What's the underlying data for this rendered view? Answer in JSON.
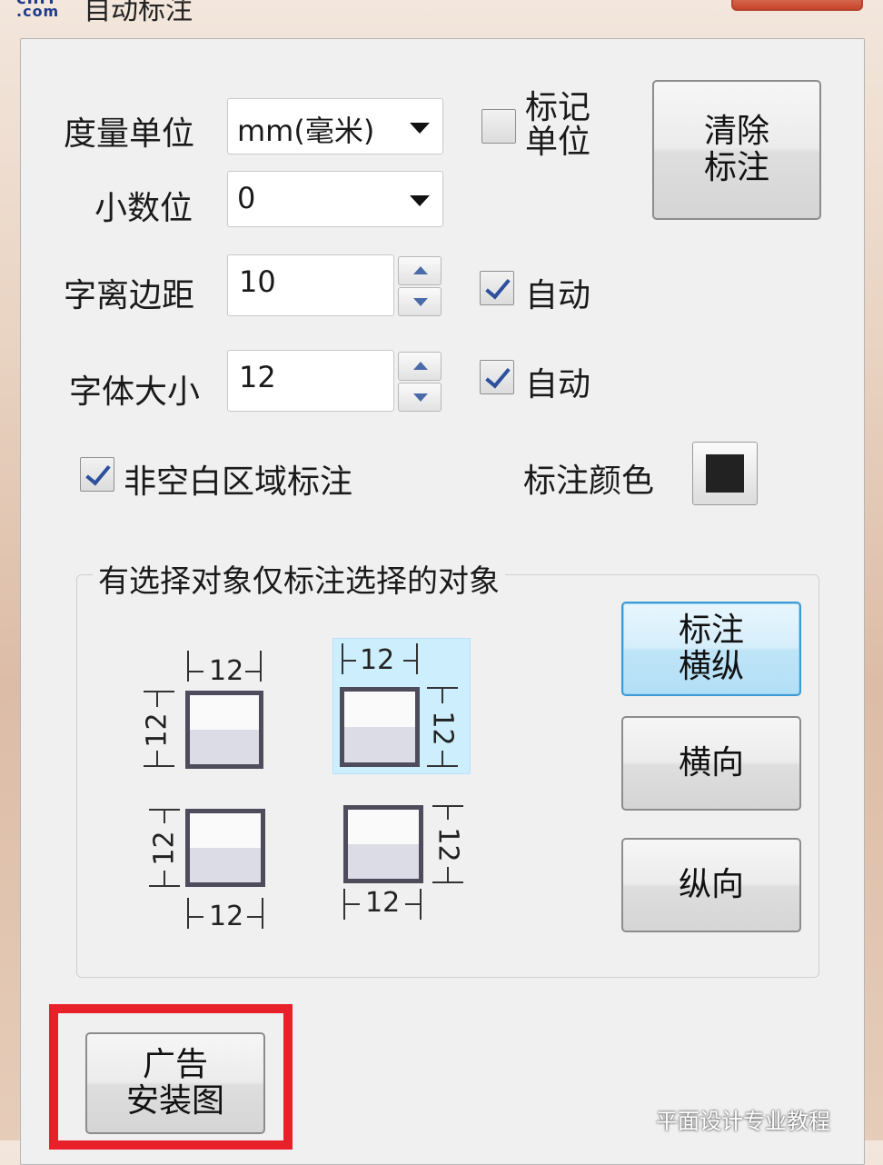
{
  "titlebar": {
    "logo_line1": "cnrr",
    "logo_line2": ".com",
    "title": "自动标注"
  },
  "units": {
    "label": "度量单位",
    "value": "mm(毫米)"
  },
  "decimals": {
    "label": "小数位",
    "value": "0"
  },
  "mark_unit": {
    "label": "标记\n单位",
    "checked": false
  },
  "clear_button": {
    "label": "清除\n标注"
  },
  "text_margin": {
    "label": "字离边距",
    "value": "10",
    "auto_label": "自动",
    "auto_checked": true
  },
  "font_size": {
    "label": "字体大小",
    "value": "12",
    "auto_label": "自动",
    "auto_checked": true
  },
  "nonblank": {
    "label": "非空白区域标注",
    "checked": true
  },
  "annot_color": {
    "label": "标注颜色",
    "color": "#222222"
  },
  "group": {
    "legend": "有选择对象仅标注选择的对象",
    "dim_value": "12",
    "buttons": {
      "both": "标注\n横纵",
      "horizontal": "横向",
      "vertical": "纵向"
    }
  },
  "ad_button": {
    "label": "广告\n安装图"
  },
  "watermark": "平面设计专业教程",
  "colors": {
    "accent": "#3c9ad6",
    "highlight_box": "#e8202a",
    "diagram_selected": "#cdeefc"
  }
}
